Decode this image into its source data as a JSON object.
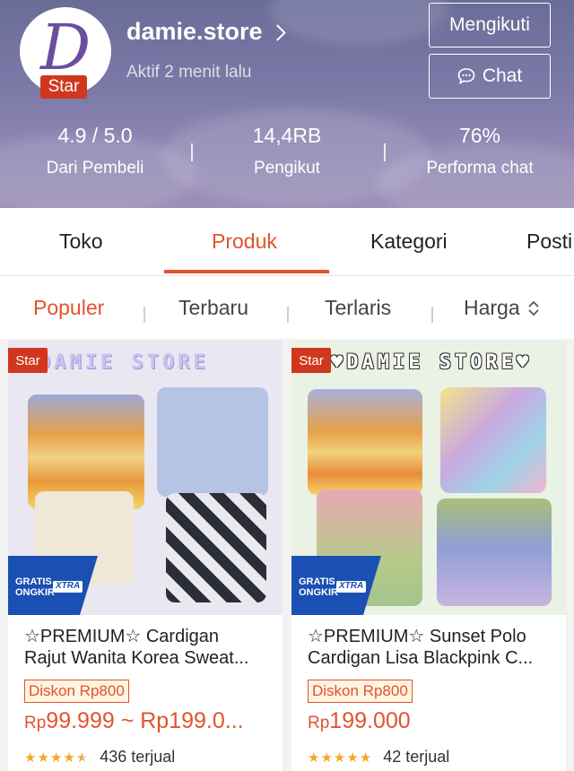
{
  "store": {
    "name": "damie.store",
    "avatar_letter": "D",
    "badge": "Star",
    "status": "Aktif 2 menit lalu",
    "follow_button": "Mengikuti",
    "chat_button": "Chat"
  },
  "stats": [
    {
      "value": "4.9 / 5.0",
      "label": "Dari Pembeli"
    },
    {
      "value": "14,4RB",
      "label": "Pengikut"
    },
    {
      "value": "76%",
      "label": "Performa chat"
    }
  ],
  "tabs": [
    "Toko",
    "Produk",
    "Kategori",
    "Posti"
  ],
  "sort": [
    "Populer",
    "Terbaru",
    "Terlaris",
    "Harga"
  ],
  "products": [
    {
      "badge": "Star",
      "image_text": "DAMIE STORE",
      "shipping_line1": "GRATIS",
      "shipping_line2": "ONGKIR",
      "shipping_tag": "XTRA",
      "title_line1": "☆PREMIUM☆ Cardigan",
      "title_line2": "Rajut Wanita Korea Sweat...",
      "discount": "Diskon Rp800",
      "price_prefix": "Rp",
      "price": "99.999 ~ Rp199.0...",
      "rating": 4.5,
      "sold": "436 terjual"
    },
    {
      "badge": "Star",
      "image_text": "♥DAMIE STORE♥",
      "shipping_line1": "GRATIS",
      "shipping_line2": "ONGKIR",
      "shipping_tag": "XTRA",
      "title_line1": "☆PREMIUM☆ Sunset Polo",
      "title_line2": "Cardigan Lisa Blackpink C...",
      "discount": "Diskon Rp800",
      "price_prefix": "Rp",
      "price": "199.000",
      "rating": 5,
      "sold": "42 terjual"
    }
  ],
  "colors": {
    "accent": "#e2532d",
    "badge_red": "#d0371e",
    "shipping_blue": "#1a4fb3",
    "star_yellow": "#f5a623"
  }
}
